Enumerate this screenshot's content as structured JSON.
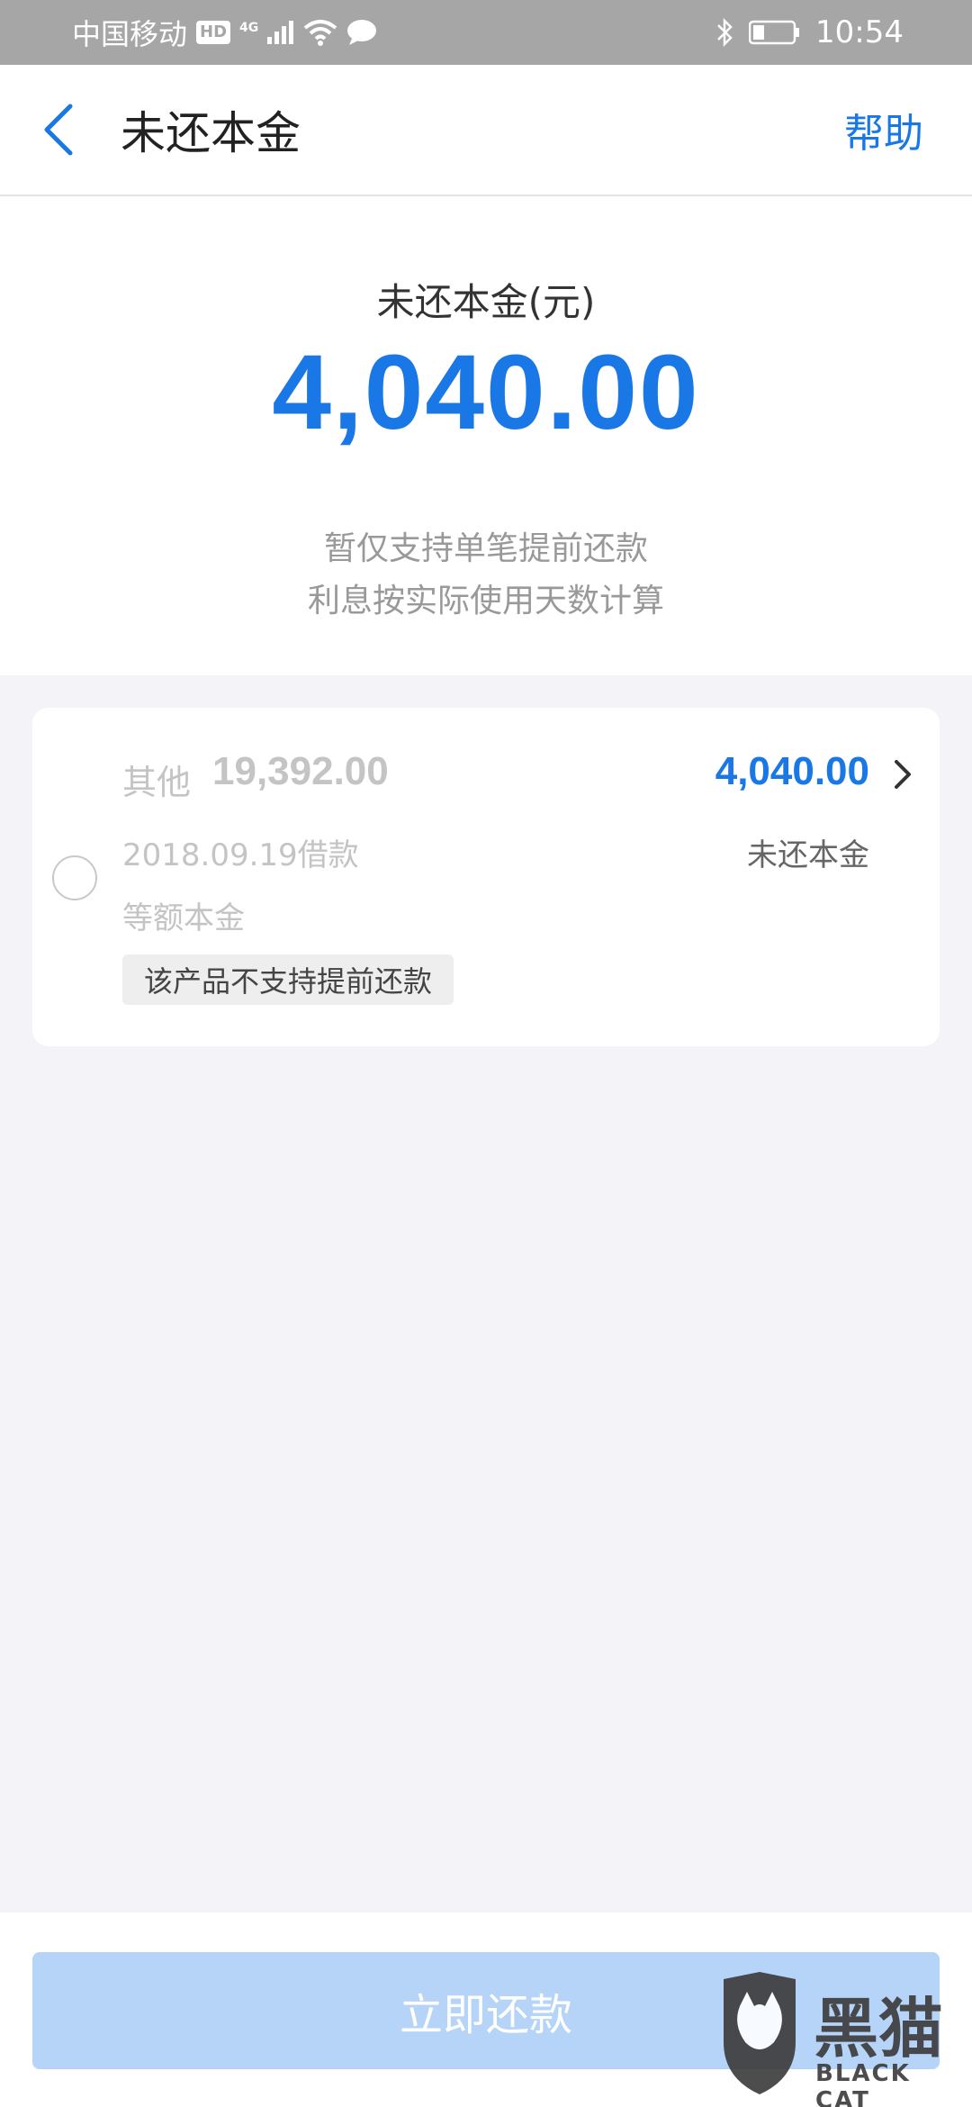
{
  "status_bar": {
    "carrier": "中国移动",
    "hd": "HD",
    "network": "4G",
    "time": "10:54"
  },
  "nav": {
    "title": "未还本金",
    "help": "帮助"
  },
  "summary": {
    "label": "未还本金(元)",
    "amount": "4,040.00",
    "note_line1": "暂仅支持单笔提前还款",
    "note_line2": "利息按实际使用天数计算"
  },
  "loan": {
    "name": "其他",
    "total": "19,392.00",
    "date": "2018.09.19借款",
    "method": "等额本金",
    "tag": "该产品不支持提前还款",
    "amount": "4,040.00",
    "amount_label": "未还本金"
  },
  "button": {
    "repay": "立即还款"
  },
  "watermark": {
    "cn": "黑猫",
    "en": "BLACK CAT"
  },
  "colors": {
    "accent": "#1a78e6",
    "button_disabled": "#b6d3f8",
    "page_bg": "#f4f4f8"
  }
}
